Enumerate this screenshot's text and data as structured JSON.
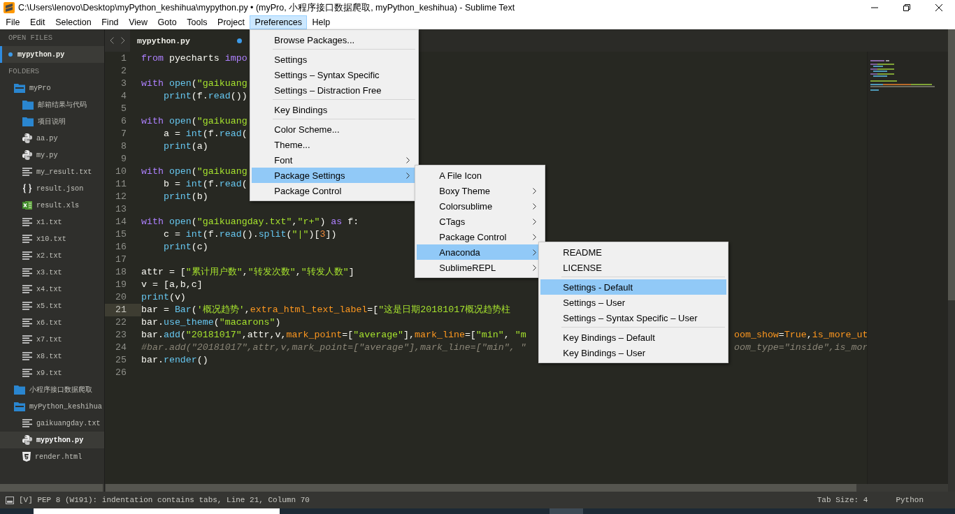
{
  "window": {
    "title": "C:\\Users\\lenovo\\Desktop\\myPython_keshihua\\mypython.py • (myPro, 小程序接口数据爬取, myPython_keshihua) - Sublime Text"
  },
  "menu_bar": [
    {
      "label": "File",
      "selected": false
    },
    {
      "label": "Edit",
      "selected": false
    },
    {
      "label": "Selection",
      "selected": false
    },
    {
      "label": "Find",
      "selected": false
    },
    {
      "label": "View",
      "selected": false
    },
    {
      "label": "Goto",
      "selected": false
    },
    {
      "label": "Tools",
      "selected": false
    },
    {
      "label": "Project",
      "selected": false
    },
    {
      "label": "Preferences",
      "selected": true,
      "items": [
        {
          "kind": "item",
          "label": "Browse Packages...",
          "selected": false,
          "has_submenu": false
        },
        {
          "kind": "separator"
        },
        {
          "kind": "item",
          "label": "Settings",
          "selected": false,
          "has_submenu": false
        },
        {
          "kind": "item",
          "label": "Settings – Syntax Specific",
          "selected": false,
          "has_submenu": false
        },
        {
          "kind": "item",
          "label": "Settings – Distraction Free",
          "selected": false,
          "has_submenu": false
        },
        {
          "kind": "separator"
        },
        {
          "kind": "item",
          "label": "Key Bindings",
          "selected": false,
          "has_submenu": false
        },
        {
          "kind": "separator"
        },
        {
          "kind": "item",
          "label": "Color Scheme...",
          "selected": false,
          "has_submenu": false
        },
        {
          "kind": "item",
          "label": "Theme...",
          "selected": false,
          "has_submenu": false
        },
        {
          "kind": "item",
          "label": "Font",
          "selected": false,
          "has_submenu": true
        },
        {
          "kind": "item",
          "label": "Package Settings",
          "selected": true,
          "has_submenu": true,
          "items": [
            {
              "kind": "item",
              "label": "A File Icon",
              "selected": false,
              "has_submenu": false
            },
            {
              "kind": "item",
              "label": "Boxy Theme",
              "selected": false,
              "has_submenu": true
            },
            {
              "kind": "item",
              "label": "Colorsublime",
              "selected": false,
              "has_submenu": true
            },
            {
              "kind": "item",
              "label": "CTags",
              "selected": false,
              "has_submenu": true
            },
            {
              "kind": "item",
              "label": "Package Control",
              "selected": false,
              "has_submenu": true
            },
            {
              "kind": "item",
              "label": "Anaconda",
              "selected": true,
              "has_submenu": true,
              "items": [
                {
                  "kind": "item",
                  "label": "README",
                  "selected": false,
                  "has_submenu": false
                },
                {
                  "kind": "item",
                  "label": "LICENSE",
                  "selected": false,
                  "has_submenu": false
                },
                {
                  "kind": "separator"
                },
                {
                  "kind": "item",
                  "label": "Settings - Default",
                  "selected": true,
                  "has_submenu": false
                },
                {
                  "kind": "item",
                  "label": "Settings – User",
                  "selected": false,
                  "has_submenu": false
                },
                {
                  "kind": "item",
                  "label": "Settings – Syntax Specific – User",
                  "selected": false,
                  "has_submenu": false
                },
                {
                  "kind": "separator"
                },
                {
                  "kind": "item",
                  "label": "Key Bindings – Default",
                  "selected": false,
                  "has_submenu": false
                },
                {
                  "kind": "item",
                  "label": "Key Bindings – User",
                  "selected": false,
                  "has_submenu": false
                }
              ]
            },
            {
              "kind": "item",
              "label": "SublimeREPL",
              "selected": false,
              "has_submenu": true
            }
          ]
        },
        {
          "kind": "item",
          "label": "Package Control",
          "selected": false,
          "has_submenu": false
        }
      ]
    },
    {
      "label": "Help",
      "selected": false
    }
  ],
  "sidebar": {
    "open_files_header": "OPEN FILES",
    "open_files": [
      {
        "name": "mypython.py",
        "modified": true,
        "selected": true
      }
    ],
    "folders_header": "FOLDERS",
    "tree": [
      {
        "name": "myPro",
        "kind": "folder",
        "expanded": true,
        "selected": false,
        "children": [
          {
            "name": "邮箱结果与代码",
            "kind": "folder",
            "expanded": false,
            "selected": false
          },
          {
            "name": "项目说明",
            "kind": "folder",
            "expanded": false,
            "selected": false
          },
          {
            "name": "aa.py",
            "kind": "python",
            "selected": false
          },
          {
            "name": "my.py",
            "kind": "python",
            "selected": false
          },
          {
            "name": "my_result.txt",
            "kind": "text",
            "selected": false
          },
          {
            "name": "result.json",
            "kind": "json",
            "selected": false
          },
          {
            "name": "result.xls",
            "kind": "excel",
            "selected": false
          },
          {
            "name": "x1.txt",
            "kind": "text",
            "selected": false
          },
          {
            "name": "x10.txt",
            "kind": "text",
            "selected": false
          },
          {
            "name": "x2.txt",
            "kind": "text",
            "selected": false
          },
          {
            "name": "x3.txt",
            "kind": "text",
            "selected": false
          },
          {
            "name": "x4.txt",
            "kind": "text",
            "selected": false
          },
          {
            "name": "x5.txt",
            "kind": "text",
            "selected": false
          },
          {
            "name": "x6.txt",
            "kind": "text",
            "selected": false
          },
          {
            "name": "x7.txt",
            "kind": "text",
            "selected": false
          },
          {
            "name": "x8.txt",
            "kind": "text",
            "selected": false
          },
          {
            "name": "x9.txt",
            "kind": "text",
            "selected": false
          }
        ]
      },
      {
        "name": "小程序接口数据爬取",
        "kind": "folder",
        "expanded": false,
        "selected": false
      },
      {
        "name": "myPython_keshihua",
        "kind": "folder",
        "expanded": true,
        "selected": false,
        "children": [
          {
            "name": "gaikuangday.txt",
            "kind": "text",
            "selected": false
          },
          {
            "name": "mypython.py",
            "kind": "python",
            "selected": true
          },
          {
            "name": "render.html",
            "kind": "html",
            "selected": false
          }
        ]
      }
    ]
  },
  "editor": {
    "tab": {
      "name": "mypython.py",
      "modified": true
    },
    "lines": [
      {
        "number": "1",
        "current": false,
        "tokens": [
          {
            "kind": "keyword",
            "text": "from"
          },
          {
            "kind": "plain",
            "text": " pyecharts"
          },
          {
            "kind": "keyword",
            "text": " impo"
          }
        ]
      },
      {
        "number": "2",
        "current": false
      },
      {
        "number": "3",
        "current": false,
        "tokens": [
          {
            "kind": "keyword",
            "text": "with"
          },
          {
            "kind": "function",
            "text": " open"
          },
          {
            "kind": "plain",
            "text": "("
          },
          {
            "kind": "string",
            "text": "\"gaikuang"
          }
        ]
      },
      {
        "number": "4",
        "current": false,
        "tokens": [
          {
            "kind": "function",
            "text": "    print"
          },
          {
            "kind": "plain",
            "text": "(f."
          },
          {
            "kind": "function",
            "text": "read"
          },
          {
            "kind": "plain",
            "text": "())"
          }
        ]
      },
      {
        "number": "5",
        "current": false
      },
      {
        "number": "6",
        "current": false,
        "tokens": [
          {
            "kind": "keyword",
            "text": "with"
          },
          {
            "kind": "function",
            "text": " open"
          },
          {
            "kind": "plain",
            "text": "("
          },
          {
            "kind": "string",
            "text": "\"gaikuang"
          }
        ]
      },
      {
        "number": "7",
        "current": false,
        "tokens": [
          {
            "kind": "plain",
            "text": "    a = "
          },
          {
            "kind": "function",
            "text": "int"
          },
          {
            "kind": "plain",
            "text": "(f."
          },
          {
            "kind": "function",
            "text": "read"
          },
          {
            "kind": "plain",
            "text": "("
          }
        ]
      },
      {
        "number": "8",
        "current": false,
        "tokens": [
          {
            "kind": "function",
            "text": "    print"
          },
          {
            "kind": "plain",
            "text": "(a)"
          }
        ]
      },
      {
        "number": "9",
        "current": false
      },
      {
        "number": "10",
        "current": false,
        "tokens": [
          {
            "kind": "keyword",
            "text": "with"
          },
          {
            "kind": "function",
            "text": " open"
          },
          {
            "kind": "plain",
            "text": "("
          },
          {
            "kind": "string",
            "text": "\"gaikuang"
          }
        ]
      },
      {
        "number": "11",
        "current": false,
        "tokens": [
          {
            "kind": "plain",
            "text": "    b = "
          },
          {
            "kind": "function",
            "text": "int"
          },
          {
            "kind": "plain",
            "text": "(f."
          },
          {
            "kind": "function",
            "text": "read"
          },
          {
            "kind": "plain",
            "text": "("
          }
        ]
      },
      {
        "number": "12",
        "current": false,
        "tokens": [
          {
            "kind": "function",
            "text": "    print"
          },
          {
            "kind": "plain",
            "text": "(b)"
          }
        ]
      },
      {
        "number": "13",
        "current": false
      },
      {
        "number": "14",
        "current": false,
        "tokens": [
          {
            "kind": "keyword",
            "text": "with"
          },
          {
            "kind": "function",
            "text": " open"
          },
          {
            "kind": "plain",
            "text": "("
          },
          {
            "kind": "string",
            "text": "\"gaikuangday.txt\""
          },
          {
            "kind": "plain",
            "text": ","
          },
          {
            "kind": "string",
            "text": "\"r+\""
          },
          {
            "kind": "plain",
            "text": ")"
          },
          {
            "kind": "keyword",
            "text": " as"
          },
          {
            "kind": "plain",
            "text": " f:"
          }
        ]
      },
      {
        "number": "15",
        "current": false,
        "tokens": [
          {
            "kind": "plain",
            "text": "    c = "
          },
          {
            "kind": "function",
            "text": "int"
          },
          {
            "kind": "plain",
            "text": "(f."
          },
          {
            "kind": "function",
            "text": "read"
          },
          {
            "kind": "plain",
            "text": "()."
          },
          {
            "kind": "function",
            "text": "split"
          },
          {
            "kind": "plain",
            "text": "("
          },
          {
            "kind": "string",
            "text": "\"|\""
          },
          {
            "kind": "plain",
            "text": ")["
          },
          {
            "kind": "number",
            "text": "3"
          },
          {
            "kind": "plain",
            "text": "])"
          }
        ]
      },
      {
        "number": "16",
        "current": false,
        "tokens": [
          {
            "kind": "function",
            "text": "    print"
          },
          {
            "kind": "plain",
            "text": "(c)"
          }
        ]
      },
      {
        "number": "17",
        "current": false
      },
      {
        "number": "18",
        "current": false,
        "tokens": [
          {
            "kind": "plain",
            "text": "attr = ["
          },
          {
            "kind": "string",
            "text": "\"累计用户数\""
          },
          {
            "kind": "plain",
            "text": ","
          },
          {
            "kind": "string",
            "text": "\"转发次数\""
          },
          {
            "kind": "plain",
            "text": ","
          },
          {
            "kind": "string",
            "text": "\"转发人数\""
          },
          {
            "kind": "plain",
            "text": "]"
          }
        ]
      },
      {
        "number": "19",
        "current": false,
        "tokens": [
          {
            "kind": "plain",
            "text": "v = [a,b,c]"
          }
        ]
      },
      {
        "number": "20",
        "current": false,
        "tokens": [
          {
            "kind": "function",
            "text": "print"
          },
          {
            "kind": "plain",
            "text": "(v)"
          }
        ]
      },
      {
        "number": "21",
        "current": true,
        "tokens": [
          {
            "kind": "plain",
            "text": "bar = "
          },
          {
            "kind": "function",
            "text": "Bar"
          },
          {
            "kind": "plain",
            "text": "("
          },
          {
            "kind": "string",
            "text": "'概况趋势'"
          },
          {
            "kind": "plain",
            "text": ","
          },
          {
            "kind": "param",
            "text": "extra_html_text_label"
          },
          {
            "kind": "plain",
            "text": "=["
          },
          {
            "kind": "string",
            "text": "\"这是日期20181017概况趋势柱"
          }
        ]
      },
      {
        "number": "22",
        "current": false,
        "tokens": [
          {
            "kind": "plain",
            "text": "bar."
          },
          {
            "kind": "function",
            "text": "use_theme"
          },
          {
            "kind": "plain",
            "text": "("
          },
          {
            "kind": "string",
            "text": "\"macarons\""
          },
          {
            "kind": "plain",
            "text": ")"
          }
        ]
      },
      {
        "number": "23",
        "current": false,
        "tokens": [
          {
            "kind": "plain",
            "text": "bar."
          },
          {
            "kind": "function",
            "text": "add"
          },
          {
            "kind": "plain",
            "text": "("
          },
          {
            "kind": "string",
            "text": "\"20181017\""
          },
          {
            "kind": "plain",
            "text": ",attr,v,"
          },
          {
            "kind": "param",
            "text": "mark_point"
          },
          {
            "kind": "plain",
            "text": "=["
          },
          {
            "kind": "string",
            "text": "\"average\""
          },
          {
            "kind": "plain",
            "text": "],"
          },
          {
            "kind": "param",
            "text": "mark_line"
          },
          {
            "kind": "plain",
            "text": "=["
          },
          {
            "kind": "string",
            "text": "\"min\""
          },
          {
            "kind": "plain",
            "text": ","
          },
          {
            "kind": "string",
            "text": " \"m"
          }
        ],
        "tail": [
          {
            "kind": "param",
            "text": "oom_show"
          },
          {
            "kind": "plain",
            "text": "="
          },
          {
            "kind": "param",
            "text": "True"
          },
          {
            "kind": "plain",
            "text": ","
          },
          {
            "kind": "param",
            "text": "is_more_ut"
          }
        ]
      },
      {
        "number": "24",
        "current": false,
        "tokens": [
          {
            "kind": "comment",
            "text": "#bar.add(\"20181017\",attr,v,mark_point=[\"average\"],mark_line=[\"min\", \""
          }
        ],
        "tail": [
          {
            "kind": "comment",
            "text": "oom_type=\"inside\",is_mor"
          }
        ]
      },
      {
        "number": "25",
        "current": false,
        "tokens": [
          {
            "kind": "plain",
            "text": "bar."
          },
          {
            "kind": "function",
            "text": "render"
          },
          {
            "kind": "plain",
            "text": "()"
          }
        ]
      },
      {
        "number": "26",
        "current": false
      }
    ]
  },
  "status_bar": {
    "message": "[V] PEP 8 (W191): indentation contains tabs, Line 21, Column 70",
    "tab_size": "Tab Size: 4",
    "syntax": "Python"
  }
}
